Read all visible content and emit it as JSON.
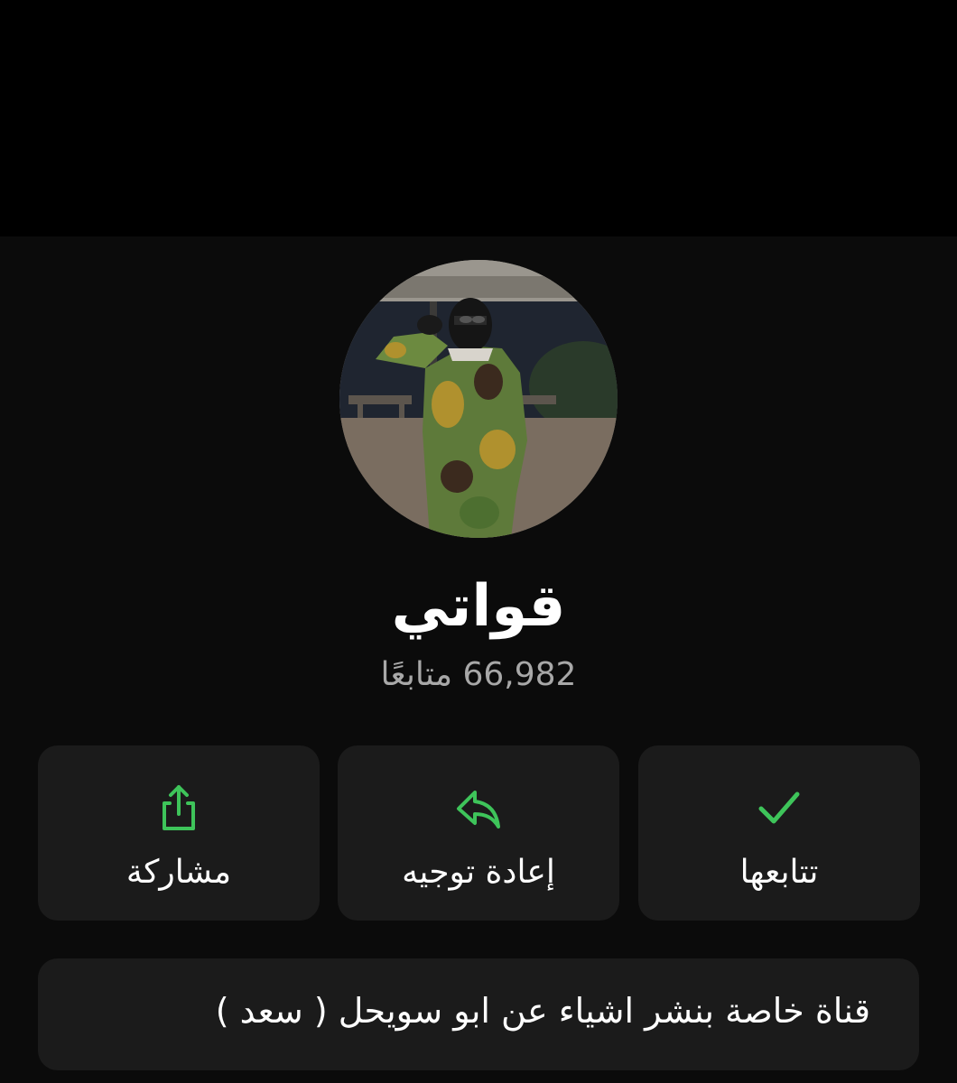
{
  "channel": {
    "name": "قواتي",
    "followers_count": "66,982",
    "followers_label": "متابعًا"
  },
  "actions": {
    "share": {
      "label": "مشاركة",
      "icon": "share-icon"
    },
    "forward": {
      "label": "إعادة توجيه",
      "icon": "forward-icon"
    },
    "following": {
      "label": "تتابعها",
      "icon": "checkmark-icon"
    }
  },
  "description": {
    "text": "قناة خاصة بنشر اشياء عن ابو سويحل ( سعد )"
  },
  "colors": {
    "accent": "#3ec45a",
    "background": "#0b0b0b",
    "card": "#1b1b1b",
    "secondary_text": "#a8a8a8"
  }
}
